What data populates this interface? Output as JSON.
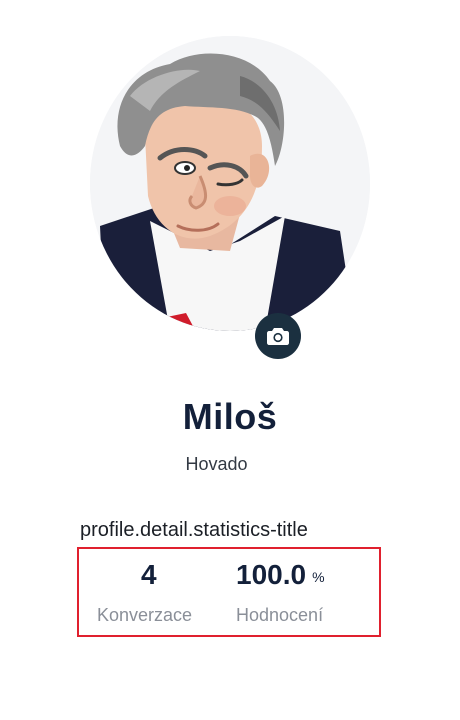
{
  "profile": {
    "name": "Miloš",
    "subtitle": "Hovado"
  },
  "statistics": {
    "title": "profile.detail.statistics-title",
    "items": [
      {
        "value": "4",
        "unit": "",
        "label": "Konverzace"
      },
      {
        "value": "100.0",
        "unit": "%",
        "label": "Hodnocení"
      }
    ]
  },
  "icons": {
    "avatar_action": "camera-icon"
  },
  "colors": {
    "accent": "#1b3040",
    "name_text": "#13203a",
    "label_text": "#8a8f98",
    "highlight_border": "#e0202e"
  }
}
